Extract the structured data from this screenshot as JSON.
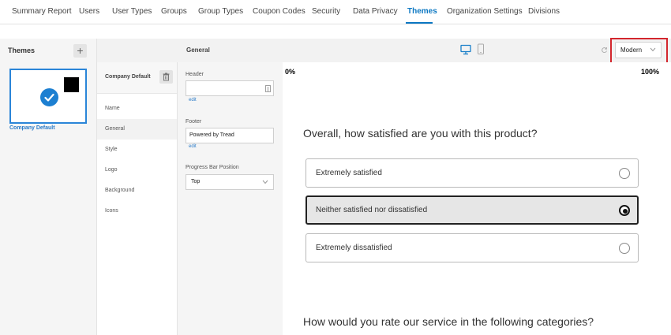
{
  "top_tabs": [
    {
      "label": "Summary Report"
    },
    {
      "label": "Users"
    },
    {
      "label": "User Types"
    },
    {
      "label": "Groups"
    },
    {
      "label": "Group Types"
    },
    {
      "label": "Coupon Codes"
    },
    {
      "label": "Security"
    },
    {
      "label": "Data Privacy"
    },
    {
      "label": "Themes",
      "active": true
    },
    {
      "label": "Organization Settings"
    },
    {
      "label": "Divisions"
    }
  ],
  "themes_panel": {
    "title": "Themes",
    "add_icon": "plus-icon",
    "theme_name": "Company Default",
    "card_check_icon": "checkmark-icon"
  },
  "nav_panel": {
    "header_label": "Company Default",
    "delete_icon": "trash-icon",
    "items": [
      {
        "label": "Name"
      },
      {
        "label": "General",
        "active": true
      },
      {
        "label": "Style"
      },
      {
        "label": "Logo"
      },
      {
        "label": "Background"
      },
      {
        "label": "Icons"
      }
    ]
  },
  "general_panel": {
    "title": "General",
    "header_label": "Header",
    "header_value": "",
    "footer_label": "Footer",
    "footer_value": "Powered by Tread",
    "edit_label": "edit",
    "progress_label": "Progress Bar Position",
    "progress_value": "Top"
  },
  "toolbar": {
    "desktop_icon": "desktop-icon",
    "mobile_icon": "mobile-icon",
    "refresh_icon": "refresh-icon",
    "layout_value": "Modern"
  },
  "preview": {
    "progress_start": "0%",
    "progress_end": "100%",
    "question1": "Overall, how satisfied are you with this product?",
    "choices": [
      {
        "label": "Extremely satisfied",
        "selected": false
      },
      {
        "label": "Neither satisfied nor dissatisfied",
        "selected": true
      },
      {
        "label": "Extremely dissatisfied",
        "selected": false
      }
    ],
    "question2": "How would you rate our service in the following categories?"
  },
  "colors": {
    "accent": "#0b77c2",
    "highlight_box": "#d3262d"
  }
}
